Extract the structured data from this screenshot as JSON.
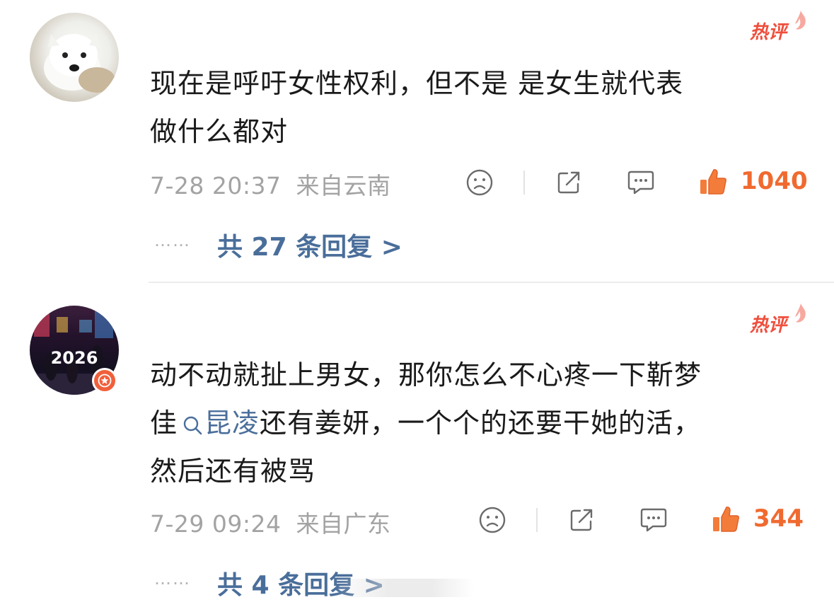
{
  "comments": [
    {
      "badge": "热评",
      "text_lines": [
        "现在是呼吁女性权利，但不是 是女生就代表",
        "做什么都对"
      ],
      "time": "7-28 20:37",
      "location": "来自云南",
      "likes": "1040",
      "replies": "共 27 条回复 >"
    },
    {
      "badge": "热评",
      "text_line1": "动不动就扯上男女，那你怎么不心疼一下靳梦",
      "line2_pre": "佳",
      "line2_link": "昆凌",
      "line2_post": "还有姜妍，一个个的还要干她的活，",
      "text_line3": "然后还有被骂",
      "avatar_text": "2026",
      "time": "7-29 09:24",
      "location": "来自广东",
      "likes": "344",
      "replies": "共 4 条回复 >"
    }
  ],
  "more_dots": "……",
  "icons": {
    "dislike": "sad-face-icon",
    "share": "share-icon",
    "comment": "comment-bubble-icon",
    "like": "thumbs-up-icon",
    "search": "search-icon",
    "vip": "star-badge-icon"
  },
  "colors": {
    "accent_blue": "#4a6e9a",
    "like_orange": "#f06a30",
    "hot_red": "#ef4e3c",
    "meta_gray": "#a3a3a3"
  }
}
